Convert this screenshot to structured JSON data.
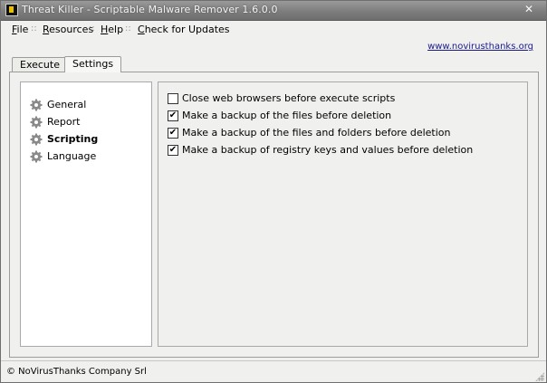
{
  "window": {
    "title": "Threat Killer - Scriptable Malware Remover 1.6.0.0",
    "close_label": "✕"
  },
  "menu": {
    "file": {
      "u": "F",
      "rest": "ile"
    },
    "resources": {
      "u": "R",
      "rest": "esources"
    },
    "help": {
      "u": "H",
      "rest": "elp"
    },
    "check": {
      "u": "C",
      "rest": "heck for Updates"
    },
    "separator": "::"
  },
  "site_link": "www.novirusthanks.org",
  "tabs": [
    {
      "label": "Execute"
    },
    {
      "label": "Settings"
    }
  ],
  "nav": {
    "items": [
      {
        "label": "General",
        "icon": "gear-icon"
      },
      {
        "label": "Report",
        "icon": "gear-icon"
      },
      {
        "label": "Scripting",
        "icon": "gear-icon",
        "selected": true
      },
      {
        "label": "Language",
        "icon": "gear-icon"
      }
    ]
  },
  "options": [
    {
      "label": "Close web browsers before execute scripts",
      "checked": false
    },
    {
      "label": "Make a backup of the files before deletion",
      "checked": true
    },
    {
      "label": "Make a backup of the files and folders before deletion",
      "checked": true
    },
    {
      "label": "Make a backup of registry keys and values before deletion",
      "checked": true
    }
  ],
  "checkbox_mark": "✔",
  "status": "© NoVirusThanks Company Srl"
}
